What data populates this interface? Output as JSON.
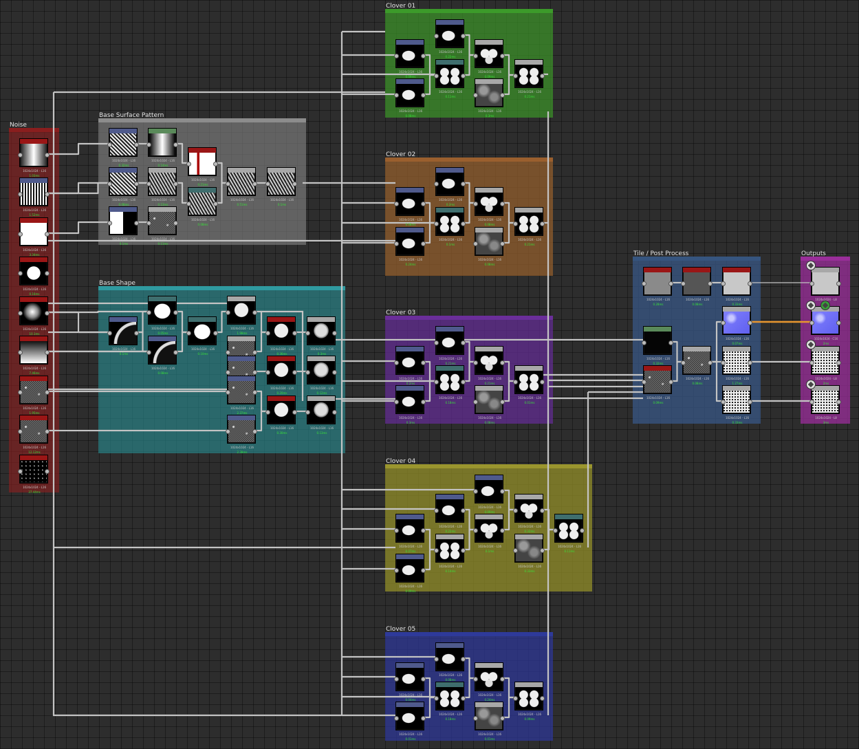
{
  "frames": {
    "noise": {
      "title": "Noise",
      "color": "#6b1d1d"
    },
    "base_surface": {
      "title": "Base Surface Pattern",
      "color": "#6a6a6a"
    },
    "base_shape": {
      "title": "Base Shape",
      "color": "#2f7d82"
    },
    "clover_01": {
      "title": "Clover 01",
      "color": "#3f8d2a"
    },
    "clover_02": {
      "title": "Clover 02",
      "color": "#8a5a2e"
    },
    "clover_03": {
      "title": "Clover 03",
      "color": "#5b2e8a"
    },
    "clover_04": {
      "title": "Clover 04",
      "color": "#85802a"
    },
    "clover_05": {
      "title": "Clover 05",
      "color": "#2e3a8a"
    },
    "tile_post": {
      "title": "Tile / Post Process",
      "color": "#2f4f7a"
    },
    "outputs": {
      "title": "Outputs",
      "color": "#8a2e8a"
    }
  },
  "colors": {
    "grid_bg": "#2d2d2d",
    "wire": "#c4c4c4",
    "wire_highlight": "#e8962e",
    "time_text": "#39e339",
    "hdr_red": "#9a1616",
    "hdr_blue": "#4f5a8c",
    "hdr_green": "#5a8a5a",
    "hdr_grey": "#a8a8a8",
    "hdr_teal": "#3f6e6e"
  },
  "nodes": [
    {
      "id": "n1",
      "frame": "noise",
      "hdr": "red",
      "thumb": "cylinder",
      "label": "1024x1024 - L16",
      "time": "1.03ms"
    },
    {
      "id": "n2",
      "frame": "noise",
      "hdr": "blue",
      "thumb": "stripes",
      "label": "1024x1024 - L16",
      "time": "1.52ms"
    },
    {
      "id": "n3",
      "frame": "noise",
      "hdr": "red",
      "thumb": "white",
      "label": "1024x1024 - L16",
      "time": "3.34ms"
    },
    {
      "id": "n4",
      "frame": "noise",
      "hdr": "red",
      "thumb": "circle",
      "label": "1024x1024 - L16",
      "time": "0.16ms"
    },
    {
      "id": "n5",
      "frame": "noise",
      "hdr": "red",
      "thumb": "sphere",
      "label": "1024x1024 - L16",
      "time": "10.1ms"
    },
    {
      "id": "n6",
      "frame": "noise",
      "hdr": "red",
      "thumb": "gradient",
      "label": "1024x1024 - L16",
      "time": "7.46ms"
    },
    {
      "id": "n7",
      "frame": "noise",
      "hdr": "red",
      "thumb": "noise",
      "label": "1024x1024 - L16",
      "time": "1.95ms"
    },
    {
      "id": "n8",
      "frame": "noise",
      "hdr": "red",
      "thumb": "noise",
      "label": "1024x1024 - L16",
      "time": "12.12ms"
    },
    {
      "id": "n9",
      "frame": "noise",
      "hdr": "red",
      "thumb": "sparse",
      "label": "1024x1024 - L16",
      "time": "37.44ms"
    },
    {
      "id": "s1",
      "frame": "base_surface",
      "hdr": "blue",
      "thumb": "diag",
      "label": "1024x1024 - L16",
      "time": "0.32ms"
    },
    {
      "id": "s2",
      "frame": "base_surface",
      "hdr": "green",
      "thumb": "vgrad",
      "label": "1024x1024 - L16",
      "time": "0.14ms"
    },
    {
      "id": "s3",
      "frame": "base_surface",
      "hdr": "red",
      "thumb": "barwhite",
      "label": "1024x1024 - L16",
      "time": "0.21ms"
    },
    {
      "id": "s4",
      "frame": "base_surface",
      "hdr": "grey",
      "thumb": "chevron",
      "label": "1024x1024 - L16",
      "time": "0.51ms"
    },
    {
      "id": "s5",
      "frame": "base_surface",
      "hdr": "grey",
      "thumb": "chevron",
      "label": "1024x1024 - L16",
      "time": "0.1ms"
    },
    {
      "id": "s6",
      "frame": "base_surface",
      "hdr": "blue",
      "thumb": "diag",
      "label": "1024x1024 - L16",
      "time": "0.08ms"
    },
    {
      "id": "s7",
      "frame": "base_surface",
      "hdr": "grey",
      "thumb": "chevron",
      "label": "1024x1024 - L16",
      "time": "0.13ms"
    },
    {
      "id": "s8",
      "frame": "base_surface",
      "hdr": "teal",
      "thumb": "chevron",
      "label": "1024x1024 - L16",
      "time": "0.08ms"
    },
    {
      "id": "s9",
      "frame": "base_surface",
      "hdr": "blue",
      "thumb": "half",
      "label": "1024x1024 - L16",
      "time": "0.1ms"
    },
    {
      "id": "s10",
      "frame": "base_surface",
      "hdr": "grey",
      "thumb": "noise",
      "label": "1024x1024 - L16",
      "time": "0.11ms"
    },
    {
      "id": "b1",
      "frame": "base_shape",
      "hdr": "blue",
      "thumb": "arc",
      "label": "1024x1024 - L16",
      "time": "0.1ms"
    },
    {
      "id": "b2",
      "frame": "base_shape",
      "hdr": "teal",
      "thumb": "blob",
      "label": "1024x1024 - L16",
      "time": "0.05ms"
    },
    {
      "id": "b3",
      "frame": "base_shape",
      "hdr": "blue",
      "thumb": "arc",
      "label": "1024x1024 - L16",
      "time": "0.08ms"
    },
    {
      "id": "b4",
      "frame": "base_shape",
      "hdr": "teal",
      "thumb": "blob",
      "label": "1024x1024 - L16",
      "time": "0.10ms"
    },
    {
      "id": "b5",
      "frame": "base_shape",
      "hdr": "grey",
      "thumb": "shield",
      "label": "1024x1024 - L16",
      "time": "1.98ms"
    },
    {
      "id": "b6",
      "frame": "base_shape",
      "hdr": "grey",
      "thumb": "noise",
      "label": "1024x1024 - L16",
      "time": "1.27ms"
    },
    {
      "id": "b7",
      "frame": "base_shape",
      "hdr": "blue",
      "thumb": "noise",
      "label": "1024x1024 - L16",
      "time": "1.0ms"
    },
    {
      "id": "b8",
      "frame": "base_shape",
      "hdr": "blue",
      "thumb": "noise",
      "label": "1024x1024 - L16",
      "time": "2.37ms"
    },
    {
      "id": "b9",
      "frame": "base_shape",
      "hdr": "blue",
      "thumb": "noise",
      "label": "1024x1024 - L16",
      "time": "2.38ms"
    },
    {
      "id": "b10",
      "frame": "base_shape",
      "hdr": "red",
      "thumb": "shield",
      "label": "1024x1024 - L16",
      "time": "0.36ms"
    },
    {
      "id": "b11",
      "frame": "base_shape",
      "hdr": "red",
      "thumb": "shield",
      "label": "1024x1024 - L16",
      "time": "0.20ms"
    },
    {
      "id": "b12",
      "frame": "base_shape",
      "hdr": "red",
      "thumb": "shield",
      "label": "1024x1024 - L16",
      "time": "0.30ms"
    },
    {
      "id": "b13",
      "frame": "base_shape",
      "hdr": "grey",
      "thumb": "shieldsoft",
      "label": "1024x1024 - L16",
      "time": "0.3ms"
    },
    {
      "id": "b14",
      "frame": "base_shape",
      "hdr": "grey",
      "thumb": "shieldsoft",
      "label": "1024x1024 - L16",
      "time": "0.12ms"
    },
    {
      "id": "b15",
      "frame": "base_shape",
      "hdr": "grey",
      "thumb": "shieldsoft",
      "label": "1024x1024 - L16",
      "time": "0.13ms"
    },
    {
      "id": "c1a",
      "frame": "clover_01",
      "hdr": "blue",
      "thumb": "leaf",
      "label": "1024x1024 - L16",
      "time": "0.22ms"
    },
    {
      "id": "c1b",
      "frame": "clover_01",
      "hdr": "blue",
      "thumb": "leaf",
      "label": "1024x1024 - L16",
      "time": "0.09ms"
    },
    {
      "id": "c1c",
      "frame": "clover_01",
      "hdr": "blue",
      "thumb": "leaf",
      "label": "1024x1024 - L16",
      "time": "0.08ms"
    },
    {
      "id": "c1d",
      "frame": "clover_01",
      "hdr": "grey",
      "thumb": "twoleaf",
      "label": "1024x1024 - L16",
      "time": "0.09ms"
    },
    {
      "id": "c1e",
      "frame": "clover_01",
      "hdr": "grey",
      "thumb": "clover",
      "label": "1024x1024 - L16",
      "time": "0.21ms"
    },
    {
      "id": "c1f",
      "frame": "clover_01",
      "hdr": "grey",
      "thumb": "blurnoise",
      "label": "1024x1024 - L16",
      "time": "0.3ms"
    },
    {
      "id": "c1g",
      "frame": "clover_01",
      "hdr": "teal",
      "thumb": "clover",
      "label": "1024x1024 - L16",
      "time": "0.11ms"
    },
    {
      "id": "c2a",
      "frame": "clover_02",
      "hdr": "blue",
      "thumb": "leaf",
      "label": "1024x1024 - L16",
      "time": "0.2ms"
    },
    {
      "id": "c2b",
      "frame": "clover_02",
      "hdr": "blue",
      "thumb": "leaf",
      "label": "1024x1024 - L16",
      "time": "0.08ms"
    },
    {
      "id": "c2c",
      "frame": "clover_02",
      "hdr": "blue",
      "thumb": "leaf",
      "label": "1024x1024 - L16",
      "time": "0.24ms"
    },
    {
      "id": "c2d",
      "frame": "clover_02",
      "hdr": "grey",
      "thumb": "twoleaf",
      "label": "1024x1024 - L16",
      "time": "0.08ms"
    },
    {
      "id": "c2e",
      "frame": "clover_02",
      "hdr": "grey",
      "thumb": "clover",
      "label": "1024x1024 - L16",
      "time": "0.21ms"
    },
    {
      "id": "c2f",
      "frame": "clover_02",
      "hdr": "grey",
      "thumb": "blurnoise",
      "label": "1024x1024 - L16",
      "time": "0.08ms"
    },
    {
      "id": "c2g",
      "frame": "clover_02",
      "hdr": "teal",
      "thumb": "clover",
      "label": "1024x1024 - L16",
      "time": "0.1ms"
    },
    {
      "id": "c3a",
      "frame": "clover_03",
      "hdr": "blue",
      "thumb": "leaf",
      "label": "1024x1024 - L16",
      "time": "0.21ms"
    },
    {
      "id": "c3b",
      "frame": "clover_03",
      "hdr": "blue",
      "thumb": "leaf",
      "label": "1024x1024 - L16",
      "time": "0.2ms"
    },
    {
      "id": "c3c",
      "frame": "clover_03",
      "hdr": "blue",
      "thumb": "leaf",
      "label": "1024x1024 - L16",
      "time": "0.3ms"
    },
    {
      "id": "c3d",
      "frame": "clover_03",
      "hdr": "grey",
      "thumb": "twoleaf",
      "label": "1024x1024 - L16",
      "time": "0.21ms"
    },
    {
      "id": "c3e",
      "frame": "clover_03",
      "hdr": "grey",
      "thumb": "clover",
      "label": "1024x1024 - L16",
      "time": "0.01ms"
    },
    {
      "id": "c3f",
      "frame": "clover_03",
      "hdr": "grey",
      "thumb": "blurnoise",
      "label": "1024x1024 - L16",
      "time": "0.08ms"
    },
    {
      "id": "c3g",
      "frame": "clover_03",
      "hdr": "teal",
      "thumb": "clover",
      "label": "1024x1024 - L16",
      "time": "0.18ms"
    },
    {
      "id": "c4a",
      "frame": "clover_04",
      "hdr": "blue",
      "thumb": "leaf",
      "label": "1024x1024 - L16",
      "time": "0.09ms"
    },
    {
      "id": "c4b",
      "frame": "clover_04",
      "hdr": "blue",
      "thumb": "leaf",
      "label": "1024x1024 - L16",
      "time": "0.22ms"
    },
    {
      "id": "c4c",
      "frame": "clover_04",
      "hdr": "blue",
      "thumb": "leaf",
      "label": "1024x1024 - L16",
      "time": "0.07ms"
    },
    {
      "id": "c4d",
      "frame": "clover_04",
      "hdr": "blue",
      "thumb": "leaf",
      "label": "1024x1024 - L16",
      "time": "0.09ms"
    },
    {
      "id": "c4e",
      "frame": "clover_04",
      "hdr": "grey",
      "thumb": "twoleaf",
      "label": "1024x1024 - L16",
      "time": "0.32ms"
    },
    {
      "id": "c4f",
      "frame": "clover_04",
      "hdr": "grey",
      "thumb": "twoleaf",
      "label": "1024x1024 - L16",
      "time": "0.1ms"
    },
    {
      "id": "c4g",
      "frame": "clover_04",
      "hdr": "grey",
      "thumb": "clover",
      "label": "1024x1024 - L16",
      "time": "0.14ms"
    },
    {
      "id": "c4h",
      "frame": "clover_04",
      "hdr": "grey",
      "thumb": "blurnoise",
      "label": "1024x1024 - L16",
      "time": "0.33ms"
    },
    {
      "id": "c4i",
      "frame": "clover_04",
      "hdr": "teal",
      "thumb": "clover",
      "label": "1024x1024 - L16",
      "time": "0.11ms"
    },
    {
      "id": "c5a",
      "frame": "clover_05",
      "hdr": "blue",
      "thumb": "leaf",
      "label": "1024x1024 - L16",
      "time": "0.08ms"
    },
    {
      "id": "c5b",
      "frame": "clover_05",
      "hdr": "blue",
      "thumb": "leaf",
      "label": "1024x1024 - L16",
      "time": "0.04ms"
    },
    {
      "id": "c5c",
      "frame": "clover_05",
      "hdr": "blue",
      "thumb": "leaf",
      "label": "1024x1024 - L16",
      "time": "0.01ms"
    },
    {
      "id": "c5d",
      "frame": "clover_05",
      "hdr": "grey",
      "thumb": "twoleaf",
      "label": "1024x1024 - L16",
      "time": "0.24ms"
    },
    {
      "id": "c5e",
      "frame": "clover_05",
      "hdr": "grey",
      "thumb": "clover",
      "label": "1024x1024 - L16",
      "time": "0.09ms"
    },
    {
      "id": "c5f",
      "frame": "clover_05",
      "hdr": "grey",
      "thumb": "blurnoise",
      "label": "1024x1024 - L16",
      "time": "0.01ms"
    },
    {
      "id": "c5g",
      "frame": "clover_05",
      "hdr": "teal",
      "thumb": "clover",
      "label": "1024x1024 - L16",
      "time": "0.18ms"
    },
    {
      "id": "t1",
      "frame": "tile_post",
      "hdr": "red",
      "thumb": "grey",
      "label": "1024x1024 - L16",
      "time": "0.28ms"
    },
    {
      "id": "t2",
      "frame": "tile_post",
      "hdr": "red",
      "thumb": "greydark",
      "label": "1024x1024 - L16",
      "time": "0.08ms"
    },
    {
      "id": "t3",
      "frame": "tile_post",
      "hdr": "red",
      "thumb": "greylight",
      "label": "1024x1024 - L16",
      "time": "0.33ms"
    },
    {
      "id": "t4",
      "frame": "tile_post",
      "hdr": "green",
      "thumb": "black",
      "label": "1024x1024 - L16",
      "time": "0.32ms"
    },
    {
      "id": "t5",
      "frame": "tile_post",
      "hdr": "red",
      "thumb": "noise",
      "label": "1024x1024 - L16",
      "time": "0.09ms"
    },
    {
      "id": "t6",
      "frame": "tile_post",
      "hdr": "grey",
      "thumb": "noise",
      "label": "1024x1024 - L16",
      "time": "0.08ms"
    },
    {
      "id": "t7",
      "frame": "tile_post",
      "hdr": "grey",
      "thumb": "normal",
      "label": "1024x1024 - L16",
      "time": "0.07ms"
    },
    {
      "id": "t8",
      "frame": "tile_post",
      "hdr": "grey",
      "thumb": "speck",
      "label": "1024x1024 - L16",
      "time": "1.27ms"
    },
    {
      "id": "t9",
      "frame": "tile_post",
      "hdr": "grey",
      "thumb": "speck",
      "label": "1024x1024 - L16",
      "time": "0.33ms"
    },
    {
      "id": "o1",
      "frame": "outputs",
      "hdr": "grey",
      "thumb": "greylight",
      "label": "1024x1024 - L8",
      "time": "2ms"
    },
    {
      "id": "o2",
      "frame": "outputs",
      "hdr": "grey",
      "thumb": "normal",
      "label": "1024x1024 - C16",
      "time": "2ms"
    },
    {
      "id": "o3",
      "frame": "outputs",
      "hdr": "grey",
      "thumb": "speck",
      "label": "1024x1024 - L8",
      "time": "2ms"
    },
    {
      "id": "o4",
      "frame": "outputs",
      "hdr": "grey",
      "thumb": "speck",
      "label": "1024x1024 - L8",
      "time": "3ms"
    }
  ]
}
